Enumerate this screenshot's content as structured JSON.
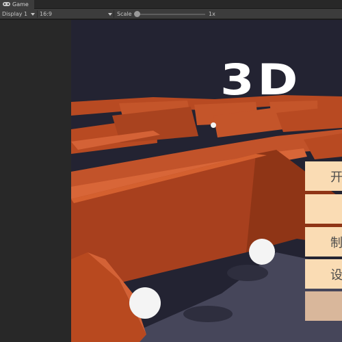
{
  "window": {
    "tab_label": "Game"
  },
  "toolbar": {
    "display_label": "Display 1",
    "aspect_label": "16:9",
    "scale_label": "Scale",
    "scale_value": "1x",
    "scale_slider_fraction": 0.0
  },
  "game": {
    "title": "3D",
    "menu_items": [
      {
        "label": "开"
      },
      {
        "label": ""
      },
      {
        "label": "制"
      },
      {
        "label": "设"
      },
      {
        "label": ""
      }
    ]
  },
  "colors": {
    "maze_wall": "#b84a22",
    "maze_wall_dark": "#7a2a12",
    "floor": "#46465a",
    "background": "#232332",
    "menu_button": "#fadcb4",
    "menu_button_pressed": "#d9b79b",
    "ball": "#f4f4f4"
  }
}
